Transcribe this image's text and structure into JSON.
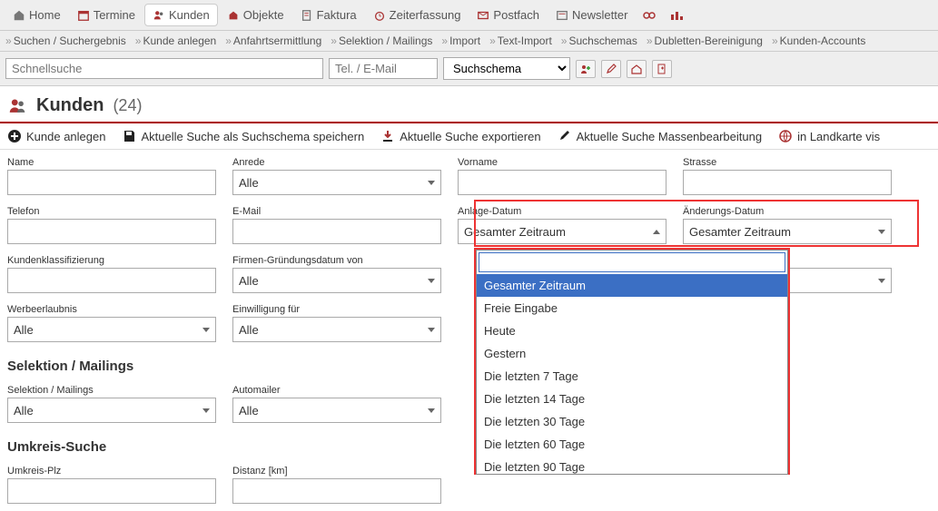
{
  "topnav": {
    "tabs": [
      {
        "label": "Home"
      },
      {
        "label": "Termine"
      },
      {
        "label": "Kunden"
      },
      {
        "label": "Objekte"
      },
      {
        "label": "Faktura"
      },
      {
        "label": "Zeiterfassung"
      },
      {
        "label": "Postfach"
      },
      {
        "label": "Newsletter"
      }
    ]
  },
  "subnav": {
    "links": [
      "Suchen / Suchergebnis",
      "Kunde anlegen",
      "Anfahrtsermittlung",
      "Selektion / Mailings",
      "Import",
      "Text-Import",
      "Suchschemas",
      "Dubletten-Bereinigung",
      "Kunden-Accounts"
    ]
  },
  "searchbar": {
    "quick_ph": "Schnellsuche",
    "tel_ph": "Tel. / E-Mail",
    "schema": "Suchschema"
  },
  "header": {
    "title": "Kunden",
    "count": "(24)"
  },
  "actions": {
    "a1": "Kunde anlegen",
    "a2": "Aktuelle Suche als Suchschema speichern",
    "a3": "Aktuelle Suche exportieren",
    "a4": "Aktuelle Suche Massenbearbeitung",
    "a5": "in Landkarte vis"
  },
  "form": {
    "name": "Name",
    "anrede": "Anrede",
    "vorname": "Vorname",
    "strasse": "Strasse",
    "telefon": "Telefon",
    "email": "E-Mail",
    "anlage": "Anlage-Datum",
    "aender": "Änderungs-Datum",
    "klass": "Kundenklassifizierung",
    "firmg": "Firmen-Gründungsdatum von",
    "werbe": "Werbeerlaubnis",
    "einw": "Einwilligung für",
    "sec1": "Selektion / Mailings",
    "selm": "Selektion / Mailings",
    "autom": "Automailer",
    "sec2": "Umkreis-Suche",
    "plz": "Umkreis-Plz",
    "dist": "Distanz [km]",
    "alle": "Alle",
    "gesamt": "Gesamter Zeitraum"
  },
  "dropdown": {
    "opts": [
      "Gesamter Zeitraum",
      "Freie Eingabe",
      "Heute",
      "Gestern",
      "Die letzten 7 Tage",
      "Die letzten 14 Tage",
      "Die letzten 30 Tage",
      "Die letzten 60 Tage",
      "Die letzten 90 Tage"
    ]
  }
}
